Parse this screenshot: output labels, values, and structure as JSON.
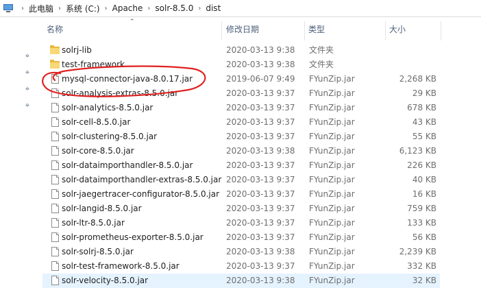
{
  "address_bar": {
    "breadcrumbs": [
      "此电脑",
      "系统 (C:)",
      "Apache",
      "solr-8.5.0",
      "dist"
    ]
  },
  "columns": {
    "name": "名称",
    "date": "修改日期",
    "type": "类型",
    "size": "大小"
  },
  "files": [
    {
      "name": "solrj-lib",
      "date": "2020-03-13 9:38",
      "type": "文件夹",
      "size": "",
      "kind": "folder-icon"
    },
    {
      "name": "test-framework",
      "date": "2020-03-13 9:38",
      "type": "文件夹",
      "size": "",
      "kind": "folder-icon"
    },
    {
      "name": "mysql-connector-java-8.0.17.jar",
      "date": "2019-06-07 9:49",
      "type": "FYunZip.jar",
      "size": "2,268 KB",
      "kind": "file-icon"
    },
    {
      "name": "solr-analysis-extras-8.5.0.jar",
      "date": "2020-03-13 9:37",
      "type": "FYunZip.jar",
      "size": "29 KB",
      "kind": "file-icon"
    },
    {
      "name": "solr-analytics-8.5.0.jar",
      "date": "2020-03-13 9:37",
      "type": "FYunZip.jar",
      "size": "678 KB",
      "kind": "file-icon"
    },
    {
      "name": "solr-cell-8.5.0.jar",
      "date": "2020-03-13 9:37",
      "type": "FYunZip.jar",
      "size": "43 KB",
      "kind": "file-icon"
    },
    {
      "name": "solr-clustering-8.5.0.jar",
      "date": "2020-03-13 9:37",
      "type": "FYunZip.jar",
      "size": "55 KB",
      "kind": "file-icon"
    },
    {
      "name": "solr-core-8.5.0.jar",
      "date": "2020-03-13 9:38",
      "type": "FYunZip.jar",
      "size": "6,123 KB",
      "kind": "file-icon"
    },
    {
      "name": "solr-dataimporthandler-8.5.0.jar",
      "date": "2020-03-13 9:37",
      "type": "FYunZip.jar",
      "size": "226 KB",
      "kind": "file-icon"
    },
    {
      "name": "solr-dataimporthandler-extras-8.5.0.jar",
      "date": "2020-03-13 9:37",
      "type": "FYunZip.jar",
      "size": "40 KB",
      "kind": "file-icon"
    },
    {
      "name": "solr-jaegertracer-configurator-8.5.0.jar",
      "date": "2020-03-13 9:37",
      "type": "FYunZip.jar",
      "size": "16 KB",
      "kind": "file-icon"
    },
    {
      "name": "solr-langid-8.5.0.jar",
      "date": "2020-03-13 9:37",
      "type": "FYunZip.jar",
      "size": "759 KB",
      "kind": "file-icon"
    },
    {
      "name": "solr-ltr-8.5.0.jar",
      "date": "2020-03-13 9:37",
      "type": "FYunZip.jar",
      "size": "133 KB",
      "kind": "file-icon"
    },
    {
      "name": "solr-prometheus-exporter-8.5.0.jar",
      "date": "2020-03-13 9:37",
      "type": "FYunZip.jar",
      "size": "56 KB",
      "kind": "file-icon"
    },
    {
      "name": "solr-solrj-8.5.0.jar",
      "date": "2020-03-13 9:38",
      "type": "FYunZip.jar",
      "size": "2,239 KB",
      "kind": "file-icon"
    },
    {
      "name": "solr-test-framework-8.5.0.jar",
      "date": "2020-03-13 9:37",
      "type": "FYunZip.jar",
      "size": "332 KB",
      "kind": "file-icon"
    },
    {
      "name": "solr-velocity-8.5.0.jar",
      "date": "2020-03-13 9:38",
      "type": "FYunZip.jar",
      "size": "32 KB",
      "kind": "file-icon",
      "selected": true
    }
  ],
  "quick_access_pins": [
    "pin-icon",
    "pin-icon",
    "pin-icon",
    "pin-icon"
  ],
  "colors": {
    "selected_row": "#e5f3ff",
    "annotation_circle": "#e02020",
    "folder": "#f8d775"
  }
}
